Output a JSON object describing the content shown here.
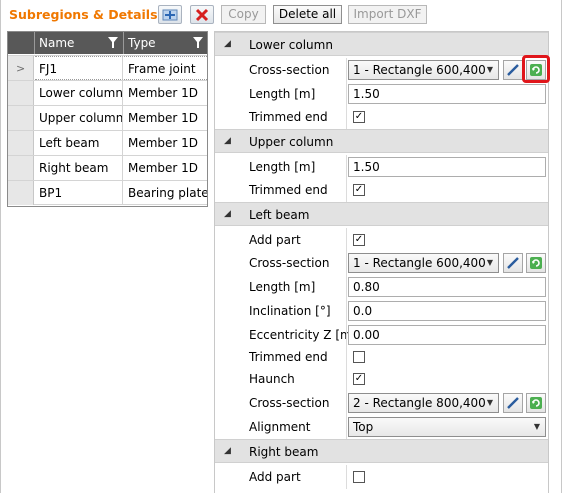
{
  "toolbar": {
    "title": "Subregions & Details",
    "add_icon": "add-icon",
    "delete_icon": "delete-icon",
    "copy_label": "Copy",
    "delete_all_label": "Delete all",
    "import_dxf_label": "Import DXF"
  },
  "grid": {
    "columns": [
      "Name",
      "Type"
    ],
    "rows": [
      {
        "name": "FJ1",
        "type": "Frame joint",
        "selected": true
      },
      {
        "name": "Lower column",
        "type": "Member 1D"
      },
      {
        "name": "Upper column",
        "type": "Member 1D"
      },
      {
        "name": "Left beam",
        "type": "Member 1D"
      },
      {
        "name": "Right beam",
        "type": "Member 1D"
      },
      {
        "name": "BP1",
        "type": "Bearing plate"
      }
    ]
  },
  "sections": {
    "lower_column": {
      "title": "Lower column",
      "cross_section_label": "Cross-section",
      "cross_section_value": "1 - Rectangle 600,400",
      "length_label": "Length [m]",
      "length_value": "1.50",
      "trimmed_end_label": "Trimmed end",
      "trimmed_end_checked": true
    },
    "upper_column": {
      "title": "Upper column",
      "length_label": "Length [m]",
      "length_value": "1.50",
      "trimmed_end_label": "Trimmed end",
      "trimmed_end_checked": true
    },
    "left_beam": {
      "title": "Left beam",
      "add_part_label": "Add part",
      "add_part_checked": true,
      "cross_section_label": "Cross-section",
      "cross_section_value": "1 - Rectangle 600,400",
      "length_label": "Length [m]",
      "length_value": "0.80",
      "inclination_label": "Inclination [°]",
      "inclination_value": "0.0",
      "eccentricity_label": "Eccentricity Z [m]",
      "eccentricity_value": "0.00",
      "trimmed_end_label": "Trimmed end",
      "trimmed_end_checked": false,
      "haunch_label": "Haunch",
      "haunch_checked": true,
      "haunch_cross_section_label": "Cross-section",
      "haunch_cross_section_value": "2 - Rectangle 800,400",
      "alignment_label": "Alignment",
      "alignment_value": "Top"
    },
    "right_beam": {
      "title": "Right beam",
      "add_part_label": "Add part",
      "add_part_checked": false
    }
  },
  "check_mark": "✓",
  "colors": {
    "title_orange": "#f07800",
    "header_dark": "#585858",
    "section_bg": "#e2e2e2",
    "highlight_red": "#e0161b"
  }
}
